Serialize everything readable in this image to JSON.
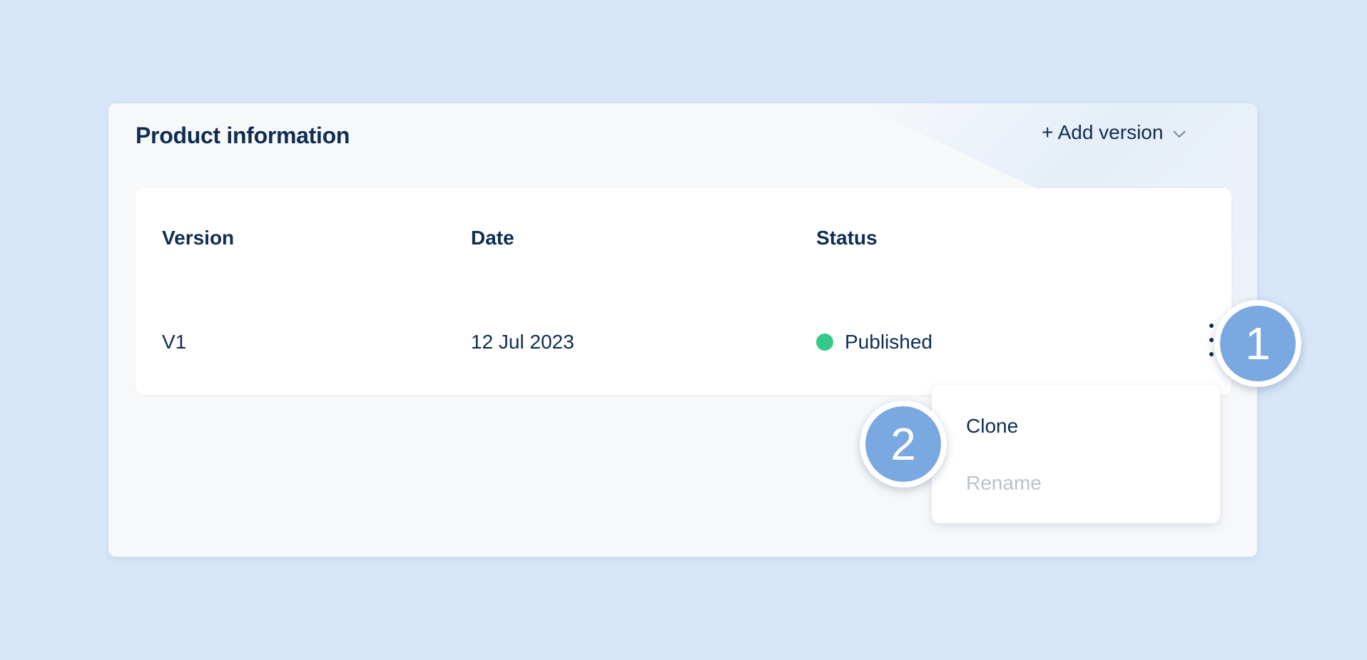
{
  "card": {
    "title": "Product information",
    "add_version_label": "+ Add version"
  },
  "table": {
    "headers": {
      "version": "Version",
      "date": "Date",
      "status": "Status"
    },
    "rows": [
      {
        "version": "V1",
        "date": "12 Jul 2023",
        "status": "Published",
        "status_color": "#34c98a"
      }
    ]
  },
  "row_menu": {
    "items": [
      {
        "label": "Clone",
        "enabled": true
      },
      {
        "label": "Rename",
        "enabled": false
      }
    ]
  },
  "annotations": {
    "step_1": "1",
    "step_2": "2"
  },
  "colors": {
    "background": "#d7e6f8",
    "text": "#0f2d52",
    "status_published": "#34c98a",
    "badge": "#7aa8e0",
    "disabled_text": "#b9c2cd"
  },
  "icons": {
    "add_version_caret": "chevron-down-icon",
    "row_actions": "more-vertical-icon",
    "status": "status-dot-icon"
  }
}
